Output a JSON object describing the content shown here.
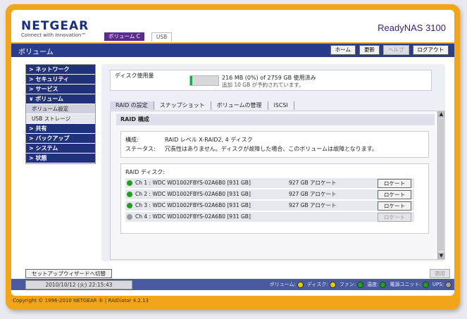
{
  "header": {
    "logo": "NETGEAR",
    "logo_tagline": "Connect with Innovation™",
    "product": "ReadyNAS 3100",
    "top_tabs": [
      {
        "label": "ボリューム C",
        "active": true
      },
      {
        "label": "USB",
        "active": false
      }
    ],
    "page_title": "ボリューム",
    "nav_buttons": [
      {
        "label": "ホーム",
        "enabled": true
      },
      {
        "label": "更新",
        "enabled": true
      },
      {
        "label": "ヘルプ",
        "enabled": false
      },
      {
        "label": "ログアウト",
        "enabled": true
      }
    ]
  },
  "sidebar": {
    "items": [
      {
        "label": "> ネットワーク"
      },
      {
        "label": "> セキュリティ"
      },
      {
        "label": "> サービス"
      },
      {
        "label": "∨ ボリューム"
      },
      {
        "label": "ボリューム設定"
      },
      {
        "label": "USB ストレージ"
      },
      {
        "label": "> 共有"
      },
      {
        "label": "> バックアップ"
      },
      {
        "label": "> システム"
      },
      {
        "label": "> 状態"
      }
    ]
  },
  "disk_usage": {
    "label": "ディスク使用量",
    "used_fraction": 0.0,
    "summary": "216 MB (0%) of 2759 GB 使用済み",
    "reserved": "追加 10 GB が予約されています。"
  },
  "tabs": [
    "RAID の設定",
    "スナップショット",
    "ボリュームの管理",
    "iSCSI"
  ],
  "raid": {
    "heading": "RAID 構成",
    "config_label": "構成:",
    "config_value": "RAID レベル X-RAID2, 4 ディスク",
    "status_label": "ステータス:",
    "status_value": "冗長性はありません。ディスクが故障した場合、このボリュームは故障となります。",
    "disks_label": "RAID ディスク:",
    "disks": [
      {
        "name": "Ch 1 : WDC WD1002FBYS-02A6B0 [931 GB]",
        "alloc": "927 GB アロケート",
        "button": "ロケート",
        "status_color": "#1fa01f",
        "enabled": true
      },
      {
        "name": "Ch 2 : WDC WD1002FBYS-02A6B0 [931 GB]",
        "alloc": "927 GB アロケート",
        "button": "ロケート",
        "status_color": "#1fa01f",
        "enabled": true
      },
      {
        "name": "Ch 3 : WDC WD1002FBYS-02A6B0 [931 GB]",
        "alloc": "927 GB アロケート",
        "button": "ロケート",
        "status_color": "#1fa01f",
        "enabled": true
      },
      {
        "name": "Ch 4 : WDC WD1002FBYS-02A6B0 [931 GB]",
        "alloc": "",
        "button": "ロケート",
        "status_color": "#9a9a9a",
        "enabled": false
      }
    ]
  },
  "bottom": {
    "wizard": "セットアップウィザードへ切替",
    "apply": "適用",
    "datetime": "2010/10/12 (火)  22:15:43"
  },
  "status_indicators": [
    {
      "label": "ボリューム:",
      "color": "#e0d000"
    },
    {
      "label": "ディスク:",
      "color": "#e0d000"
    },
    {
      "label": "ファン:",
      "color": "#1fa01f"
    },
    {
      "label": "温度:",
      "color": "#1fa01f"
    },
    {
      "label": "電源ユニット:",
      "color": "#1fa01f"
    },
    {
      "label": "UPS:",
      "color": "#a0a0a0"
    }
  ],
  "footer": "Copyright © 1996-2010 NETGEAR ® | RAIDiator 4.2.13"
}
